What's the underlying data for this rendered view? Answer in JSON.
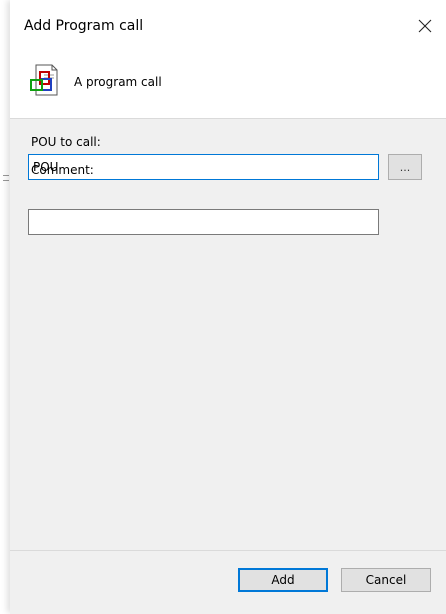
{
  "dialog": {
    "title": "Add Program call",
    "header_text": "A program call"
  },
  "form": {
    "pou_label": "POU to call:",
    "pou_value": "POU",
    "browse_label": "...",
    "comment_label": "Comment:",
    "comment_value": ""
  },
  "buttons": {
    "add_label": "Add",
    "cancel_label": "Cancel"
  },
  "colors": {
    "focus_accent": "#0078d7",
    "panel_background": "#f0f0f0"
  },
  "icons": {
    "close": "close-icon",
    "header": "program-call-icon"
  }
}
